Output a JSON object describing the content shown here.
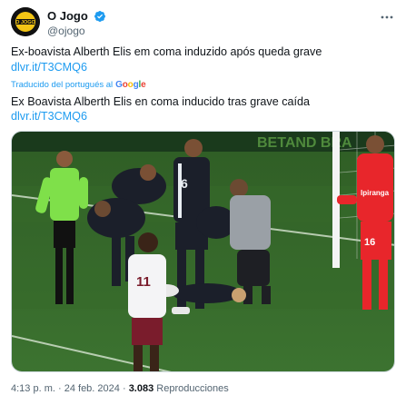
{
  "author": {
    "display_name": "O Jogo",
    "handle": "@ojogo",
    "avatar_text": "O JOGO",
    "verified_icon": "verified-badge-icon"
  },
  "tweet": {
    "text": "Ex-boavista Alberth Elis em coma induzido após queda grave",
    "link": "dlvr.it/T3CMQ6"
  },
  "translation": {
    "label": "Traducido del portugués al",
    "provider": "Google",
    "text": "Ex Boavista Alberth Elis en coma inducido tras grave caída",
    "link": "dlvr.it/T3CMQ6"
  },
  "photo": {
    "player_number_black": "6",
    "player_number_white": "11",
    "keeper_number": "16",
    "sponsor": "Ipiranga",
    "boarding_text": "BETAND BRA"
  },
  "meta": {
    "time": "4:13 p. m.",
    "date": "24 feb. 2024",
    "views_count": "3.083",
    "views_label": "Reproducciones"
  },
  "colors": {
    "link": "#1d9bf0",
    "secondary_text": "#536471",
    "referee_shirt": "#7fe04a",
    "keeper_shirt": "#e8262b"
  }
}
